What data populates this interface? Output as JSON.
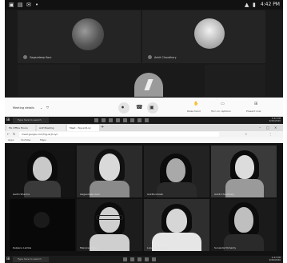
{
  "status_bar": {
    "time": "4:42 PM"
  },
  "top_call": {
    "participants": [
      {
        "name": "Gagandeep Kaur",
        "avatar_icon": "avatar-photo-icon"
      },
      {
        "name": "Ankit Choudhary",
        "avatar_icon": "avatar-photo-icon"
      }
    ],
    "meeting_details_label": "Meeting details",
    "controls": [
      {
        "icon": "mic-off-icon",
        "color": "#e8e8e8"
      },
      {
        "icon": "end-call-icon",
        "color": "#e8e8e8"
      },
      {
        "icon": "camera-icon",
        "color": "#e8e8e8"
      }
    ],
    "right_actions": [
      {
        "label": "Raise hand",
        "icon": "raise-hand-icon"
      },
      {
        "label": "Turn on captions",
        "icon": "captions-icon"
      },
      {
        "label": "Present now",
        "icon": "present-icon"
      }
    ]
  },
  "taskbar_top": {
    "search_placeholder": "Type here to search",
    "time": "4:42 PM",
    "date": "9/26/2020"
  },
  "browser": {
    "tabs": [
      {
        "label": "ML Office Hours"
      },
      {
        "label": "ALP Meeting"
      },
      {
        "label": "Meet - fxg-wrjt-xy"
      }
    ],
    "url": "meet.google.com/fxg-wrjt-xyz",
    "bookmarks": [
      "Apps",
      "YouTube",
      "Maps"
    ]
  },
  "grid": {
    "participants": [
      {
        "name": "Aadhi Sharma"
      },
      {
        "name": "Gagandeep Kaur"
      },
      {
        "name": "Ankita Ghosh"
      },
      {
        "name": "Ankit Choudhary"
      },
      {
        "name": "Kalpana Lamba"
      },
      {
        "name": "Manpreet Kaur"
      },
      {
        "name": "Lopamudra Das"
      },
      {
        "name": "Sunanda Mohanty"
      }
    ]
  },
  "taskbar_bottom": {
    "search_placeholder": "Type here to search",
    "time": "4:43 PM",
    "date": "9/26/2020"
  }
}
